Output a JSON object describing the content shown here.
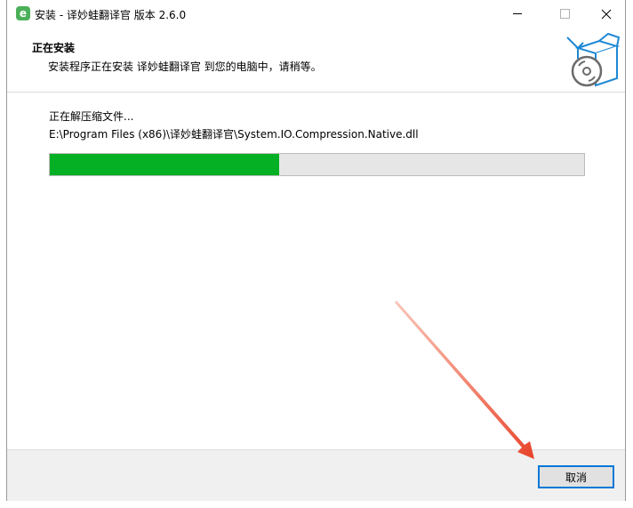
{
  "window": {
    "title": "安装 - 译妙蛙翻译官 版本 2.6.0",
    "app_icon_letter": "e",
    "controls": {
      "minimize": "minimize-icon",
      "maximize": "maximize-icon",
      "close": "close-icon"
    }
  },
  "header": {
    "title": "正在安装",
    "subtitle": "安装程序正在安装 译妙蛙翻译官 到您的电脑中，请稍等。",
    "graphic_icon": "box-with-disc-icon"
  },
  "main": {
    "status": "正在解压缩文件...",
    "file_path": "E:\\Program Files (x86)\\译妙蛙翻译官\\System.IO.Compression.Native.dll",
    "progress_fraction": 0.43
  },
  "footer": {
    "cancel_label": "取消"
  },
  "colors": {
    "progress_fill": "#06b025",
    "progress_track": "#e6e6e6",
    "annotation_arrow": "#e8432a",
    "button_focus_border": "#0078d7",
    "footer_bg": "#f0f0f0"
  }
}
